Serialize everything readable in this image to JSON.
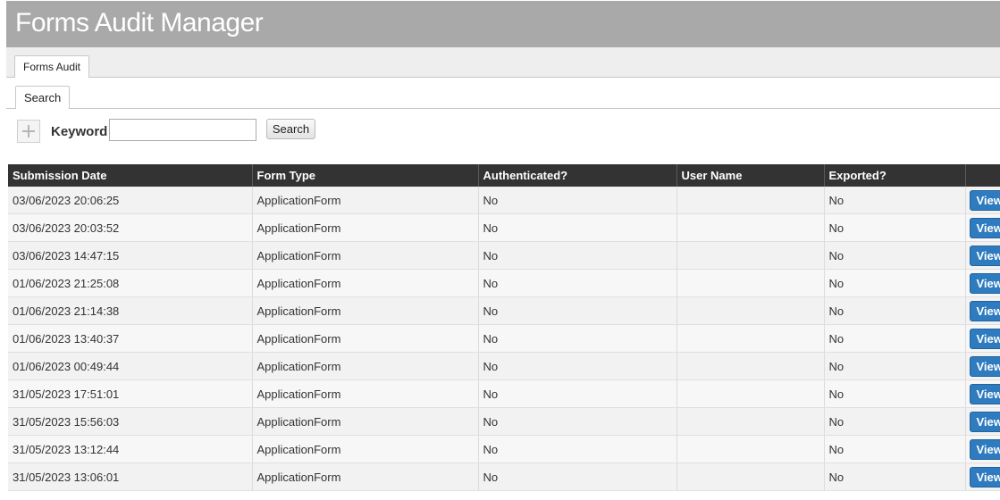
{
  "app": {
    "title": "Forms Audit Manager"
  },
  "tabs": {
    "outer": "Forms Audit",
    "inner": "Search"
  },
  "search": {
    "keyword_label": "Keyword",
    "keyword_value": "",
    "button_label": "Search"
  },
  "table": {
    "columns": [
      "Submission Date",
      "Form Type",
      "Authenticated?",
      "User Name",
      "Exported?",
      ""
    ],
    "rows": [
      {
        "date": "03/06/2023 20:06:25",
        "type": "ApplicationForm",
        "auth": "No",
        "user": "",
        "exported": "No",
        "action": "View"
      },
      {
        "date": "03/06/2023 20:03:52",
        "type": "ApplicationForm",
        "auth": "No",
        "user": "",
        "exported": "No",
        "action": "View"
      },
      {
        "date": "03/06/2023 14:47:15",
        "type": "ApplicationForm",
        "auth": "No",
        "user": "",
        "exported": "No",
        "action": "View"
      },
      {
        "date": "01/06/2023 21:25:08",
        "type": "ApplicationForm",
        "auth": "No",
        "user": "",
        "exported": "No",
        "action": "View"
      },
      {
        "date": "01/06/2023 21:14:38",
        "type": "ApplicationForm",
        "auth": "No",
        "user": "",
        "exported": "No",
        "action": "View"
      },
      {
        "date": "01/06/2023 13:40:37",
        "type": "ApplicationForm",
        "auth": "No",
        "user": "",
        "exported": "No",
        "action": "View"
      },
      {
        "date": "01/06/2023 00:49:44",
        "type": "ApplicationForm",
        "auth": "No",
        "user": "",
        "exported": "No",
        "action": "View"
      },
      {
        "date": "31/05/2023 17:51:01",
        "type": "ApplicationForm",
        "auth": "No",
        "user": "",
        "exported": "No",
        "action": "View"
      },
      {
        "date": "31/05/2023 15:56:03",
        "type": "ApplicationForm",
        "auth": "No",
        "user": "",
        "exported": "No",
        "action": "View"
      },
      {
        "date": "31/05/2023 13:12:44",
        "type": "ApplicationForm",
        "auth": "No",
        "user": "",
        "exported": "No",
        "action": "View"
      },
      {
        "date": "31/05/2023 13:06:01",
        "type": "ApplicationForm",
        "auth": "No",
        "user": "",
        "exported": "No",
        "action": "View"
      }
    ]
  },
  "colors": {
    "header_bg": "#a9a9a9",
    "table_header_bg": "#333333",
    "view_button": "#2e7bbf"
  },
  "icons": {
    "add": "plus-icon"
  }
}
